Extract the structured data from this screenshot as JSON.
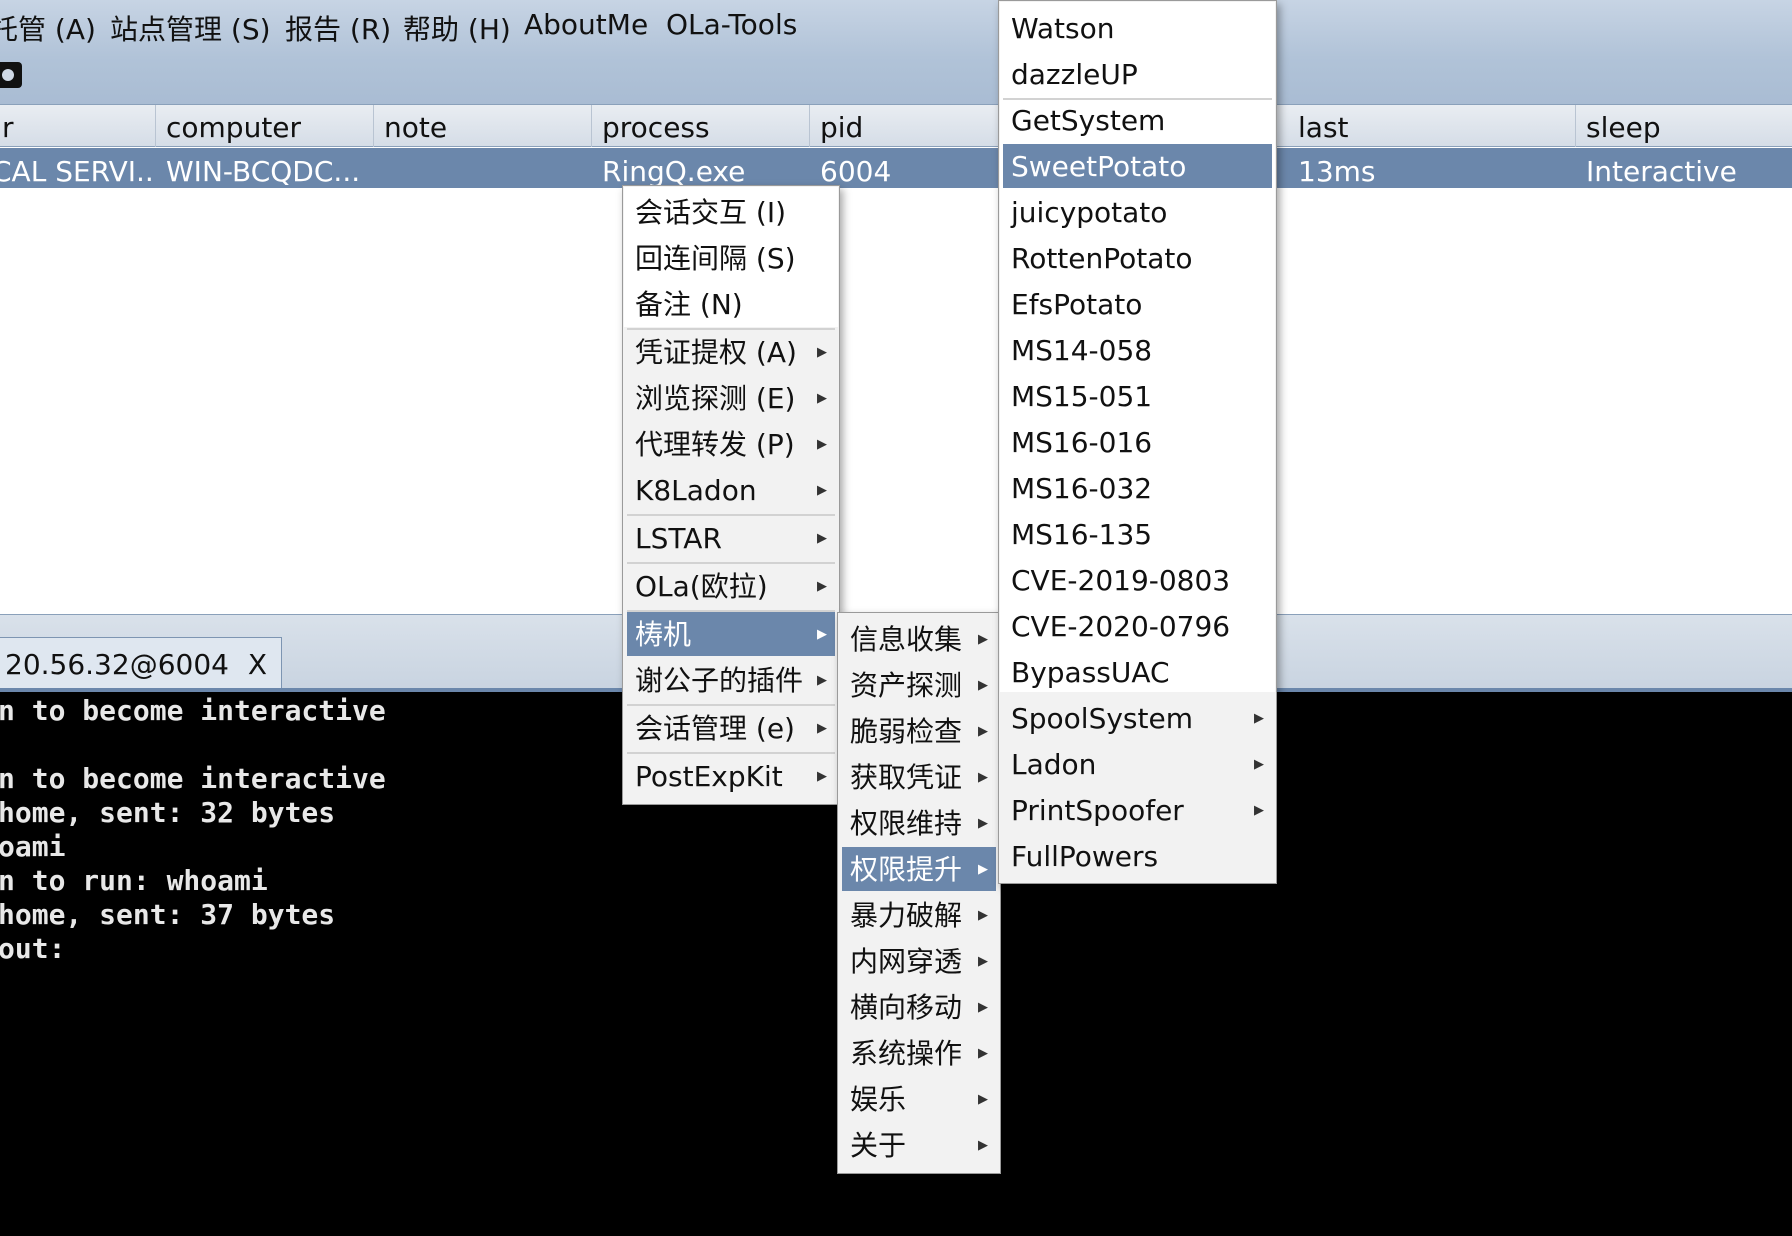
{
  "menubar": {
    "items": [
      "托管 (A)",
      "站点管理 (S)",
      "报告 (R)",
      "帮助 (H)",
      "AboutMe",
      "OLa-Tools"
    ]
  },
  "table": {
    "columns": [
      "r",
      "computer",
      "note",
      "process",
      "pid",
      "last",
      "sleep"
    ],
    "row": {
      "user": "CAL SERVI...",
      "computer": "WIN-BCQDC...",
      "note": "",
      "process": "RingQ.exe",
      "pid": "6004",
      "last": "13ms",
      "sleep": "Interactive"
    }
  },
  "tab": {
    "label": "20.56.32@6004",
    "close": "X"
  },
  "console": {
    "lines": [
      "n to become interactive",
      "",
      "n to become interactive",
      "home, sent: 32 bytes",
      "oami",
      "n to run: whoami",
      "home, sent: 37 bytes",
      "out:"
    ]
  },
  "context_menu": {
    "items": [
      {
        "label": "会话交互 (I)",
        "submenu": false
      },
      {
        "label": "回连间隔 (S)",
        "submenu": false
      },
      {
        "label": "备注 (N)",
        "submenu": false
      },
      {
        "label": "凭证提权 (A)",
        "submenu": true
      },
      {
        "label": "浏览探测 (E)",
        "submenu": true
      },
      {
        "label": "代理转发 (P)",
        "submenu": true
      },
      {
        "label": "K8Ladon",
        "submenu": true
      },
      {
        "label": "LSTAR",
        "submenu": true
      },
      {
        "label": "OLa(欧拉)",
        "submenu": true
      },
      {
        "label": "梼机",
        "submenu": true,
        "selected": true
      },
      {
        "label": "谢公子的插件",
        "submenu": true
      },
      {
        "label": "会话管理 (e)",
        "submenu": true
      },
      {
        "label": "PostExpKit",
        "submenu": true
      }
    ]
  },
  "submenu_1": {
    "items": [
      "信息收集",
      "资产探测",
      "脆弱检查",
      "获取凭证",
      "权限维持",
      "权限提升",
      "暴力破解",
      "内网穿透",
      "横向移动",
      "系统操作",
      "娱乐",
      "关于"
    ],
    "selected": "权限提升"
  },
  "submenu_2": {
    "items": [
      "Watson",
      "dazzleUP",
      "GetSystem",
      "SweetPotato",
      "juicypotato",
      "RottenPotato",
      "EfsPotato",
      "MS14-058",
      "MS15-051",
      "MS16-016",
      "MS16-032",
      "MS16-135",
      "CVE-2019-0803",
      "CVE-2020-0796",
      "BypassUAC"
    ],
    "items_with_submenu": [
      "SpoolSystem",
      "Ladon",
      "PrintSpoofer"
    ],
    "last": "FullPowers",
    "selected": "SweetPotato"
  },
  "colors": {
    "selection": "#6b87ab",
    "menubar": "#b1c3d8",
    "console_bg": "#000000"
  }
}
